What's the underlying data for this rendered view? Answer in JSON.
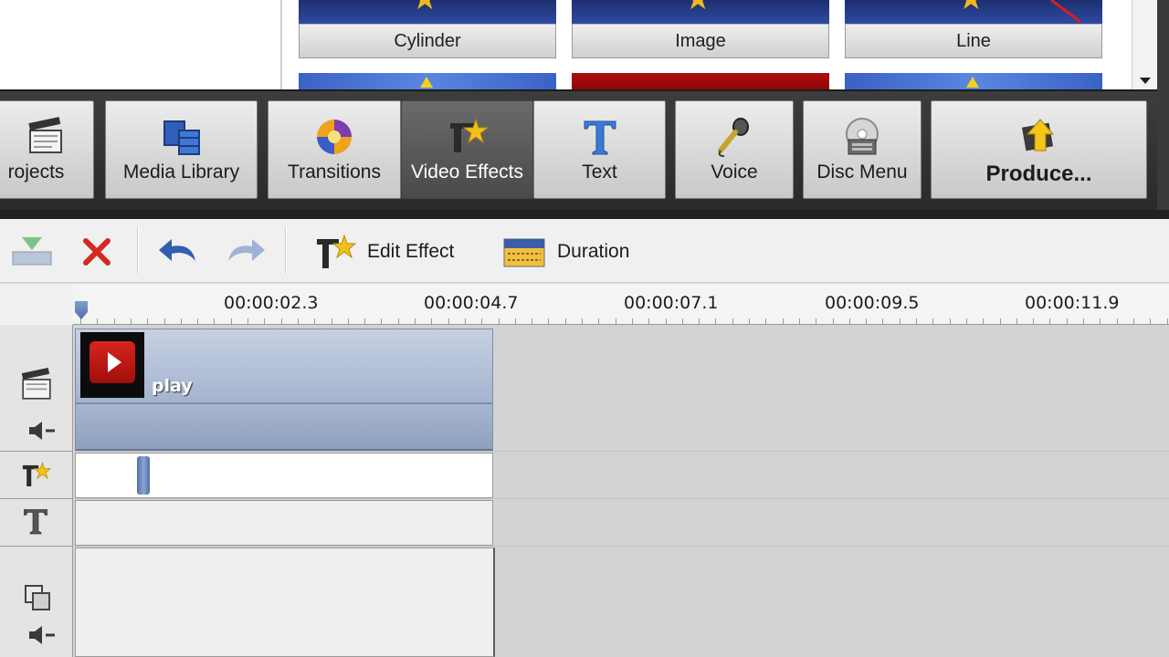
{
  "gallery": {
    "tiles": [
      {
        "label": "Cylinder"
      },
      {
        "label": "Image"
      },
      {
        "label": "Line"
      }
    ]
  },
  "toolbar": {
    "buttons": [
      {
        "label": "rojects"
      },
      {
        "label": "Media Library"
      },
      {
        "label": "Transitions"
      },
      {
        "label": "Video Effects",
        "active": true
      },
      {
        "label": "Text"
      },
      {
        "label": "Voice"
      },
      {
        "label": "Disc Menu"
      },
      {
        "label": "Produce..."
      }
    ]
  },
  "edit_toolbar": {
    "edit_effect_label": "Edit Effect",
    "duration_label": "Duration"
  },
  "timeline": {
    "ruler_labels": [
      "00:00:02.3",
      "00:00:04.7",
      "00:00:07.1",
      "00:00:09.5",
      "00:00:11.9"
    ],
    "clip": {
      "name": "play"
    }
  },
  "colors": {
    "active_button": "#555555",
    "clip_fill": "#a4b3cf",
    "thumb_red": "#c81a16",
    "star": "#f0b81a"
  }
}
